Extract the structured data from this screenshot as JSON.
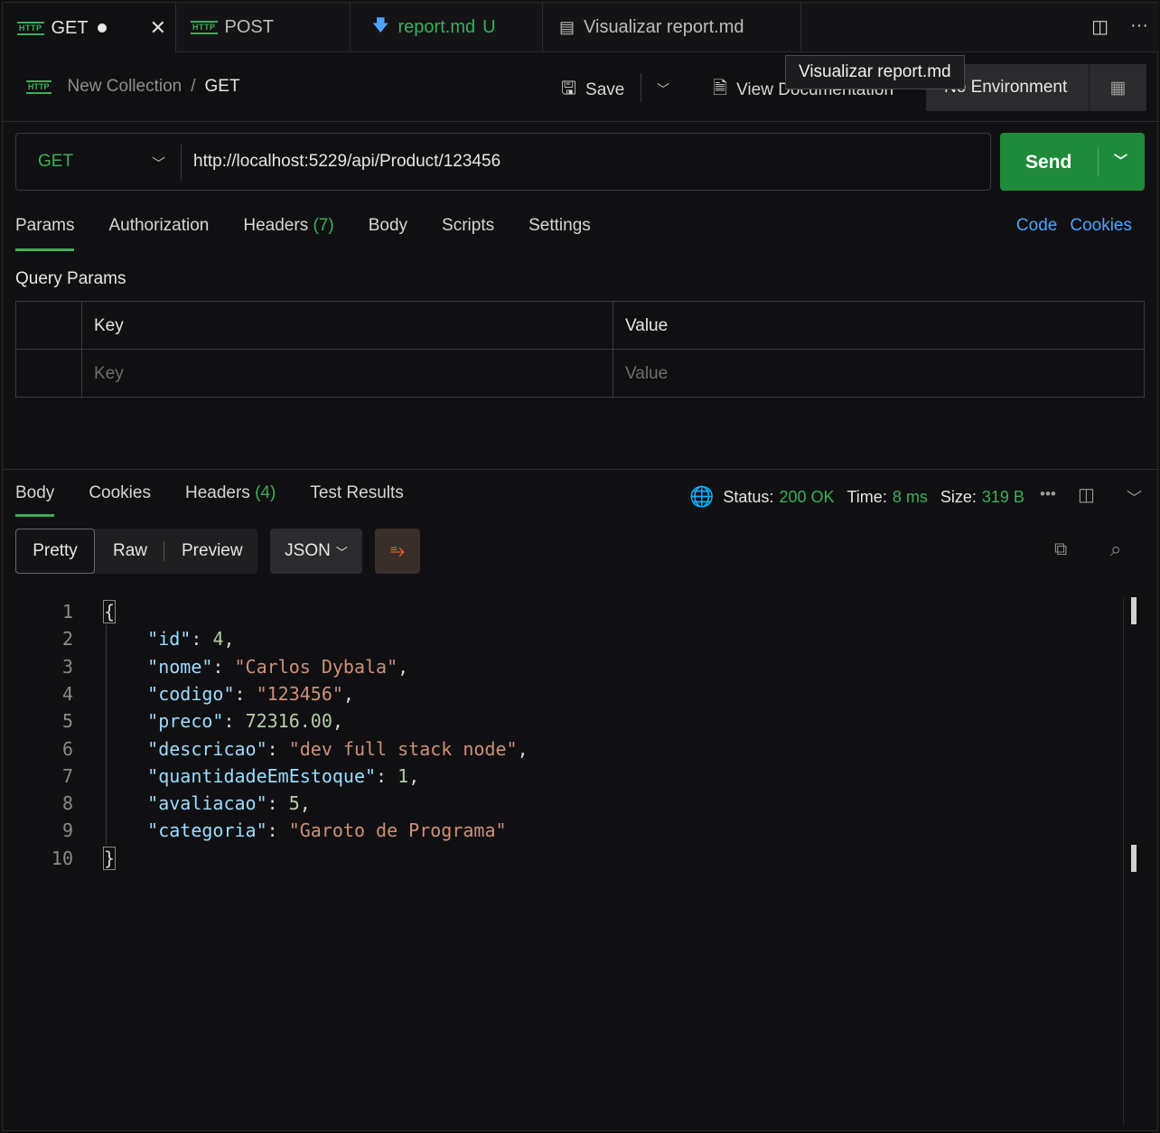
{
  "tabs": [
    {
      "label": "GET",
      "badge": "HTTP",
      "unsaved": true,
      "active": true
    },
    {
      "label": "POST",
      "badge": "HTTP",
      "active": false
    },
    {
      "label": "report.md",
      "status": "U",
      "active": false
    },
    {
      "label": "Visualizar report.md",
      "active": false
    }
  ],
  "breadcrumb": {
    "collection": "New Collection",
    "separator": "/",
    "current": "GET",
    "badge": "HTTP"
  },
  "toolbar": {
    "save_label": "Save",
    "view_doc_label": "View Documentation",
    "environment_label": "No Environment",
    "tooltip": "Visualizar report.md"
  },
  "request": {
    "method": "GET",
    "url": "http://localhost:5229/api/Product/123456",
    "send_label": "Send"
  },
  "request_tabs": [
    {
      "label": "Params",
      "active": true
    },
    {
      "label": "Authorization"
    },
    {
      "label": "Headers",
      "count": "(7)"
    },
    {
      "label": "Body"
    },
    {
      "label": "Scripts"
    },
    {
      "label": "Settings"
    }
  ],
  "links": {
    "code": "Code",
    "cookies": "Cookies"
  },
  "query_params": {
    "title": "Query Params",
    "col_key": "Key",
    "col_value": "Value",
    "key_placeholder": "Key",
    "value_placeholder": "Value"
  },
  "response_tabs": [
    {
      "label": "Body",
      "active": true
    },
    {
      "label": "Cookies"
    },
    {
      "label": "Headers",
      "count": "(4)"
    },
    {
      "label": "Test Results"
    }
  ],
  "response_status": {
    "status_label": "Status:",
    "status_value": "200 OK",
    "time_label": "Time:",
    "time_value": "8 ms",
    "size_label": "Size:",
    "size_value": "319 B"
  },
  "format": {
    "pretty": "Pretty",
    "raw": "Raw",
    "preview": "Preview",
    "type": "JSON"
  },
  "code_lines": [
    {
      "n": "1",
      "parts": [
        [
          "p",
          "{"
        ]
      ]
    },
    {
      "n": "2",
      "parts": [
        [
          "p",
          "    "
        ],
        [
          "k",
          "\"id\""
        ],
        [
          "p",
          ": "
        ],
        [
          "n",
          "4"
        ],
        [
          "p",
          ","
        ]
      ]
    },
    {
      "n": "3",
      "parts": [
        [
          "p",
          "    "
        ],
        [
          "k",
          "\"nome\""
        ],
        [
          "p",
          ": "
        ],
        [
          "s",
          "\"Carlos Dybala\""
        ],
        [
          "p",
          ","
        ]
      ]
    },
    {
      "n": "4",
      "parts": [
        [
          "p",
          "    "
        ],
        [
          "k",
          "\"codigo\""
        ],
        [
          "p",
          ": "
        ],
        [
          "s",
          "\"123456\""
        ],
        [
          "p",
          ","
        ]
      ]
    },
    {
      "n": "5",
      "parts": [
        [
          "p",
          "    "
        ],
        [
          "k",
          "\"preco\""
        ],
        [
          "p",
          ": "
        ],
        [
          "n",
          "72316.00"
        ],
        [
          "p",
          ","
        ]
      ]
    },
    {
      "n": "6",
      "parts": [
        [
          "p",
          "    "
        ],
        [
          "k",
          "\"descricao\""
        ],
        [
          "p",
          ": "
        ],
        [
          "s",
          "\"dev full stack node\""
        ],
        [
          "p",
          ","
        ]
      ]
    },
    {
      "n": "7",
      "parts": [
        [
          "p",
          "    "
        ],
        [
          "k",
          "\"quantidadeEmEstoque\""
        ],
        [
          "p",
          ": "
        ],
        [
          "n",
          "1"
        ],
        [
          "p",
          ","
        ]
      ]
    },
    {
      "n": "8",
      "parts": [
        [
          "p",
          "    "
        ],
        [
          "k",
          "\"avaliacao\""
        ],
        [
          "p",
          ": "
        ],
        [
          "n",
          "5"
        ],
        [
          "p",
          ","
        ]
      ]
    },
    {
      "n": "9",
      "parts": [
        [
          "p",
          "    "
        ],
        [
          "k",
          "\"categoria\""
        ],
        [
          "p",
          ": "
        ],
        [
          "s",
          "\"Garoto de Programa\""
        ]
      ]
    },
    {
      "n": "10",
      "parts": [
        [
          "p",
          "}"
        ]
      ]
    }
  ],
  "colors": {
    "accent_green": "#3dae5a",
    "send_bg": "#1f8a3a",
    "link_blue": "#4ea3ff",
    "wrap_orange": "#ff6c37"
  }
}
